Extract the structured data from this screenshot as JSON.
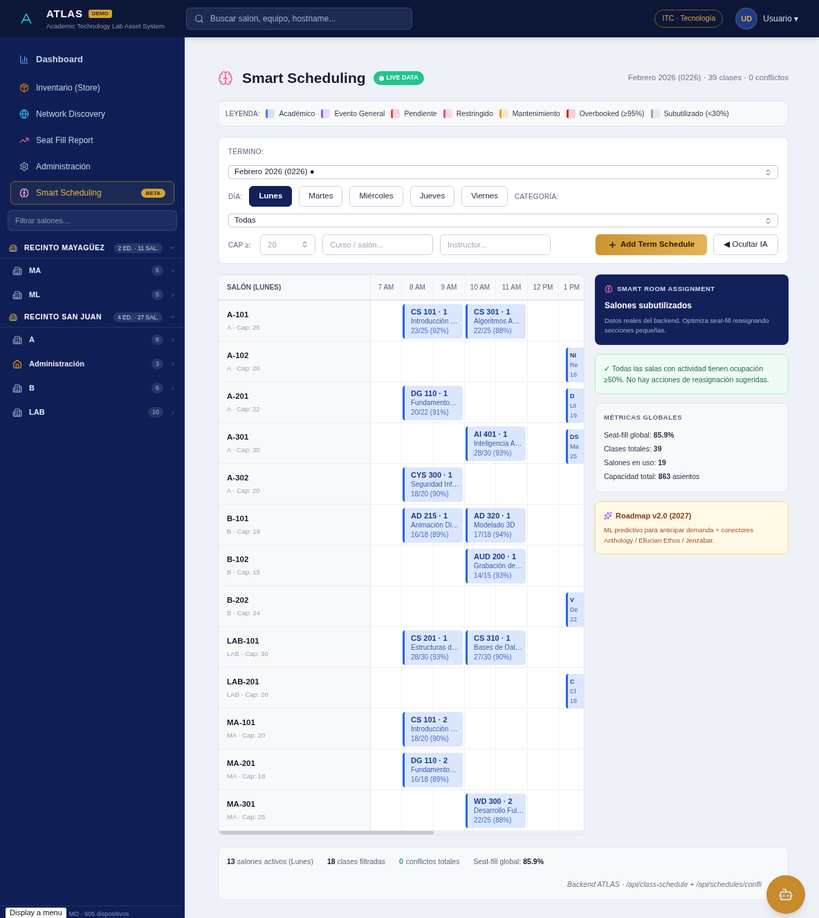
{
  "header": {
    "brand": "ATLAS",
    "badge": "DEMO",
    "subtitle": "Academic Technology Lab Asset System",
    "search": {
      "placeholder": "Buscar salon, equipo, hostname..."
    },
    "org": "ITC · Tecnología",
    "avatar": "UD",
    "user": "Usuario ▾"
  },
  "sidebar": {
    "nav": [
      {
        "label": "Dashboard",
        "selected": false
      },
      {
        "label": "Inventario (Store)",
        "selected": false
      },
      {
        "label": "Network Discovery",
        "selected": false
      },
      {
        "label": "Seat Fill Report",
        "selected": false
      },
      {
        "label": "Administración",
        "selected": false
      },
      {
        "label": "Smart Scheduling",
        "selected": true,
        "badge": "BETA"
      }
    ],
    "filter": {
      "placeholder": "Filtrar salones..."
    },
    "campuses": [
      {
        "name": "RECINTO MAYAGÜEZ",
        "badge": "2 ED. · 11 SAL.",
        "expanded": true,
        "children": [
          {
            "name": "MA",
            "count": "6",
            "kind": "building"
          },
          {
            "name": "ML",
            "count": "5",
            "kind": "building"
          }
        ]
      },
      {
        "name": "RECINTO SAN JUAN",
        "badge": "4 ED. · 27 SAL.",
        "expanded": true,
        "children": [
          {
            "name": "A",
            "count": "8",
            "kind": "building"
          },
          {
            "name": "Administración",
            "count": "3",
            "kind": "house"
          },
          {
            "name": "B",
            "count": "6",
            "kind": "building"
          },
          {
            "name": "LAB",
            "count": "10",
            "kind": "building"
          }
        ]
      }
    ],
    "footer": "MO · 605 dispositivos",
    "tooltip": "Display a menu"
  },
  "page": {
    "title": "Smart Scheduling",
    "live": "LIVE DATA",
    "summary": "Febrero 2026 (0226) · 39 clases · 0 conflictos"
  },
  "legend": {
    "label": "LEYENDA:",
    "items": [
      {
        "label": "Académico",
        "color": "#3b82f6"
      },
      {
        "label": "Evento General",
        "color": "#8b5cf6"
      },
      {
        "label": "Pendiente",
        "color": "#ef4444"
      },
      {
        "label": "Restringido",
        "color": "#ec4899"
      },
      {
        "label": "Mantenimiento",
        "color": "#f59e0b"
      },
      {
        "label": "Overbooked (≥95%)",
        "color": "#dc2626"
      },
      {
        "label": "Subutilizado (<30%)",
        "color": "#9ca3af"
      }
    ]
  },
  "filters": {
    "term_label": "TÉRMINO:",
    "term": "Febrero 2026 (0226) ●",
    "day_label": "DÍA:",
    "days": [
      {
        "label": "Lunes",
        "selected": true
      },
      {
        "label": "Martes",
        "selected": false
      },
      {
        "label": "Miércoles",
        "selected": false
      },
      {
        "label": "Jueves",
        "selected": false
      },
      {
        "label": "Viernes",
        "selected": false
      }
    ],
    "category_label": "CATEGORÍA:",
    "category": "Todas",
    "cap_label": "CAP ≥:",
    "cap": {
      "placeholder": "20"
    },
    "course": {
      "placeholder": "Curso / salón..."
    },
    "instructor": {
      "placeholder": "Instructor..."
    },
    "add_button": "Add Term Schedule",
    "hide_button": "◀ Ocultar IA"
  },
  "schedule": {
    "room_header": "SALÓN (LUNES)",
    "times": [
      "7 AM",
      "8 AM",
      "9 AM",
      "10 AM",
      "11 AM",
      "12 PM",
      "1 PM"
    ],
    "rows": [
      {
        "room": "A-101",
        "meta": "A · Cap: 25",
        "cells": [
          {
            "kind": "empty"
          },
          {
            "kind": "full",
            "code": "CS 101 · 1",
            "name": "Introducción …",
            "fill": "23/25 (92%)"
          },
          {
            "kind": "empty"
          },
          {
            "kind": "full",
            "code": "CS 301 · 1",
            "name": "Algoritmos A…",
            "fill": "22/25 (88%)"
          },
          {
            "kind": "empty"
          },
          {
            "kind": "empty"
          },
          {
            "kind": "empty"
          }
        ]
      },
      {
        "room": "A-102",
        "meta": "A · Cap: 20",
        "cells": [
          {
            "kind": "empty"
          },
          {
            "kind": "empty"
          },
          {
            "kind": "empty"
          },
          {
            "kind": "empty"
          },
          {
            "kind": "empty"
          },
          {
            "kind": "empty"
          },
          {
            "kind": "partial",
            "code": "NI",
            "name": "Re",
            "fill": "18"
          }
        ]
      },
      {
        "room": "A-201",
        "meta": "A · Cap: 22",
        "cells": [
          {
            "kind": "empty"
          },
          {
            "kind": "full",
            "code": "DG 110 · 1",
            "name": "Fundamento…",
            "fill": "20/22 (91%)"
          },
          {
            "kind": "empty"
          },
          {
            "kind": "empty"
          },
          {
            "kind": "empty"
          },
          {
            "kind": "empty"
          },
          {
            "kind": "partial",
            "code": "D",
            "name": "UI",
            "fill": "19"
          }
        ]
      },
      {
        "room": "A-301",
        "meta": "A · Cap: 30",
        "cells": [
          {
            "kind": "empty"
          },
          {
            "kind": "empty"
          },
          {
            "kind": "empty"
          },
          {
            "kind": "full",
            "code": "AI 401 · 1",
            "name": "Inteligencia A…",
            "fill": "28/30 (93%)"
          },
          {
            "kind": "empty"
          },
          {
            "kind": "empty"
          },
          {
            "kind": "partial",
            "code": "DS",
            "name": "Ma",
            "fill": "25"
          }
        ]
      },
      {
        "room": "A-302",
        "meta": "A · Cap: 20",
        "cells": [
          {
            "kind": "empty"
          },
          {
            "kind": "full",
            "code": "CYS 300 · 1",
            "name": "Seguridad Inf…",
            "fill": "18/20 (90%)"
          },
          {
            "kind": "empty"
          },
          {
            "kind": "empty"
          },
          {
            "kind": "empty"
          },
          {
            "kind": "empty"
          },
          {
            "kind": "empty"
          }
        ]
      },
      {
        "room": "B-101",
        "meta": "B · Cap: 18",
        "cells": [
          {
            "kind": "empty"
          },
          {
            "kind": "full",
            "code": "AD 215 · 1",
            "name": "Animación Di…",
            "fill": "16/18 (89%)"
          },
          {
            "kind": "empty"
          },
          {
            "kind": "full",
            "code": "AD 320 · 1",
            "name": "Modelado 3D",
            "fill": "17/18 (94%)"
          },
          {
            "kind": "empty"
          },
          {
            "kind": "empty"
          },
          {
            "kind": "empty"
          }
        ]
      },
      {
        "room": "B-102",
        "meta": "B · Cap: 15",
        "cells": [
          {
            "kind": "empty"
          },
          {
            "kind": "empty"
          },
          {
            "kind": "empty"
          },
          {
            "kind": "full",
            "code": "AUD 200 · 1",
            "name": "Grabación de…",
            "fill": "14/15 (93%)"
          },
          {
            "kind": "empty"
          },
          {
            "kind": "empty"
          },
          {
            "kind": "empty"
          }
        ]
      },
      {
        "room": "B-202",
        "meta": "B · Cap: 24",
        "cells": [
          {
            "kind": "empty"
          },
          {
            "kind": "empty"
          },
          {
            "kind": "empty"
          },
          {
            "kind": "empty"
          },
          {
            "kind": "empty"
          },
          {
            "kind": "empty"
          },
          {
            "kind": "partial",
            "code": "V",
            "name": "De",
            "fill": "22"
          }
        ]
      },
      {
        "room": "LAB-101",
        "meta": "LAB · Cap: 30",
        "cells": [
          {
            "kind": "empty"
          },
          {
            "kind": "full",
            "code": "CS 201 · 1",
            "name": "Estructuras d…",
            "fill": "28/30 (93%)"
          },
          {
            "kind": "empty"
          },
          {
            "kind": "full",
            "code": "CS 310 · 1",
            "name": "Bases de Dat…",
            "fill": "27/30 (90%)"
          },
          {
            "kind": "empty"
          },
          {
            "kind": "empty"
          },
          {
            "kind": "empty"
          }
        ]
      },
      {
        "room": "LAB-201",
        "meta": "LAB · Cap: 20",
        "cells": [
          {
            "kind": "empty"
          },
          {
            "kind": "empty"
          },
          {
            "kind": "empty"
          },
          {
            "kind": "empty"
          },
          {
            "kind": "empty"
          },
          {
            "kind": "empty"
          },
          {
            "kind": "partial",
            "code": "C",
            "name": "Cl",
            "fill": "18"
          }
        ]
      },
      {
        "room": "MA-101",
        "meta": "MA · Cap: 20",
        "cells": [
          {
            "kind": "empty"
          },
          {
            "kind": "full",
            "code": "CS 101 · 2",
            "name": "Introducción …",
            "fill": "18/20 (90%)"
          },
          {
            "kind": "empty"
          },
          {
            "kind": "empty"
          },
          {
            "kind": "empty"
          },
          {
            "kind": "empty"
          },
          {
            "kind": "empty"
          }
        ]
      },
      {
        "room": "MA-201",
        "meta": "MA · Cap: 18",
        "cells": [
          {
            "kind": "empty"
          },
          {
            "kind": "full",
            "code": "DG 110 · 2",
            "name": "Fundamento…",
            "fill": "16/18 (89%)"
          },
          {
            "kind": "empty"
          },
          {
            "kind": "empty"
          },
          {
            "kind": "empty"
          },
          {
            "kind": "empty"
          },
          {
            "kind": "empty"
          }
        ]
      },
      {
        "room": "MA-301",
        "meta": "MA · Cap: 25",
        "cells": [
          {
            "kind": "empty"
          },
          {
            "kind": "empty"
          },
          {
            "kind": "empty"
          },
          {
            "kind": "full",
            "code": "WD 300 · 2",
            "name": "Desarrollo Ful…",
            "fill": "22/25 (88%)"
          },
          {
            "kind": "empty"
          },
          {
            "kind": "empty"
          },
          {
            "kind": "empty"
          }
        ]
      }
    ]
  },
  "assistant": {
    "eyebrow": "SMART ROOM ASSIGNMENT",
    "title": "Salones subutilizados",
    "text": "Datos reales del backend. Optimiza seat-fill reasignando secciones pequeñas.",
    "notice": "✓ Todas las salas con actividad tienen ocupación ≥50%. No hay acciones de reasignación sugeridas.",
    "metrics_title": "MÉTRICAS GLOBALES",
    "metrics": [
      "Seat-fill global: **85.9%**",
      "Clases totales: **39**",
      "Salones en uso: **19**",
      "Capacidad total: **863** asientos"
    ],
    "roadmap_title": "Roadmap v2.0 (2027)",
    "roadmap_text": "ML predictivo para anticipar demanda + conectores Anthology / Ellucian Ethos / Jenzabar."
  },
  "footer": {
    "stats": [
      "**13** salones activos (Lunes)",
      "**18** clases filtradas",
      "conflictos totales",
      "Seat-fill global: **85.9%**"
    ],
    "conflicts": "0",
    "source": "Backend ATLAS · /api/class-schedule + /api/schedules/confli"
  }
}
